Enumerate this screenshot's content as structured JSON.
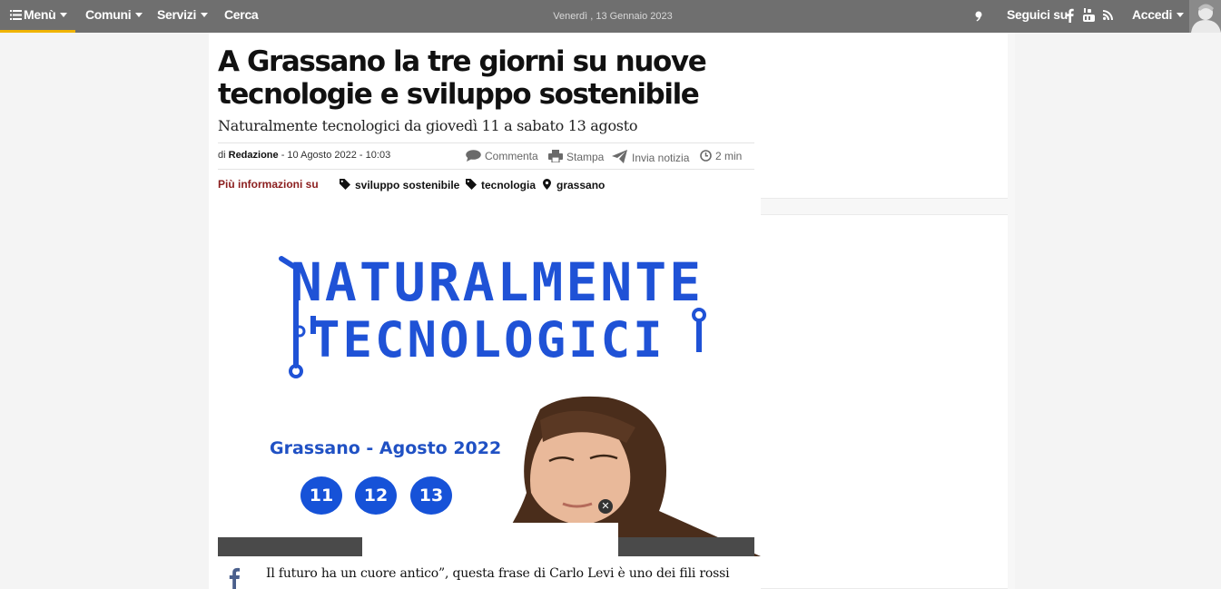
{
  "topbar": {
    "menu_label": "Menù",
    "nav": [
      "Comuni",
      "Servizi",
      "Cerca"
    ],
    "date": "Venerdì , 13 Gennaio 2023",
    "follow_label": "Seguici su",
    "login_label": "Accedi"
  },
  "article": {
    "headline": "A Grassano la tre giorni su nuove tecnologie e sviluppo sostenibile",
    "subtitle": "Naturalmente tecnologici da giovedì 11 a sabato 13 agosto",
    "byline_prefix": "di",
    "author": "Redazione",
    "byline_date": "- 10 Agosto 2022 - 10:03",
    "actions": {
      "comment": "Commenta",
      "print": "Stampa",
      "send": "Invia notizia",
      "read_time": "2 min"
    },
    "tags_label": "Più informazioni su",
    "tags": [
      "sviluppo sostenibile",
      "tecnologia",
      "grassano"
    ],
    "hero": {
      "line1": "NATURALMENTE",
      "line2": "TECNOLOGICI",
      "place_date": "Grassano - Agosto 2022",
      "days": [
        "11",
        "12",
        "13"
      ]
    },
    "body_first_line": "Il futuro ha un cuore antico”, questa frase di  Carlo Levi è uno dei fili rossi"
  },
  "colors": {
    "topbar": "#6f6f6f",
    "menu_underline": "#f0b400",
    "tags_label": "#8b1e1e",
    "hero_blue": "#1652d8"
  }
}
